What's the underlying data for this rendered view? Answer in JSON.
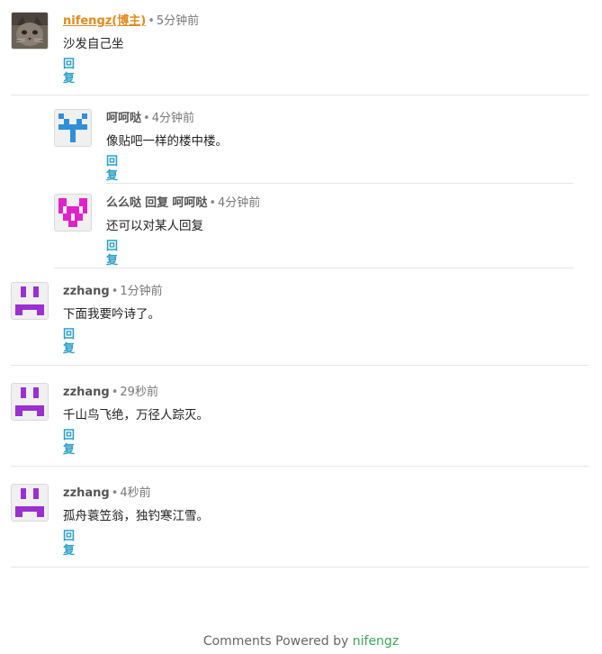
{
  "comments": [
    {
      "author": "nifengz(博主)",
      "time": "5分钟前",
      "text": "沙发自己坐",
      "reply": "回复",
      "avatar": "cat-photo-avatar"
    },
    {
      "author": "呵呵哒",
      "time": "4分钟前",
      "text": "像贴吧一样的楼中楼。",
      "reply": "回复",
      "avatar": "identicon-blue"
    },
    {
      "author": "么么哒",
      "reply_word": "回复",
      "reply_to": "呵呵哒",
      "time": "4分钟前",
      "text": "还可以对某人回复",
      "reply": "回复",
      "avatar": "identicon-magenta"
    },
    {
      "author": "zzhang",
      "time": "1分钟前",
      "text": "下面我要吟诗了。",
      "reply": "回复",
      "avatar": "identicon-purple"
    },
    {
      "author": "zzhang",
      "time": "29秒前",
      "text": "千山鸟飞绝，万径人踪灭。",
      "reply": "回复",
      "avatar": "identicon-purple"
    },
    {
      "author": "zzhang",
      "time": "4秒前",
      "text": "孤舟蓑笠翁，独钓寒江雪。",
      "reply": "回复",
      "avatar": "identicon-purple"
    }
  ],
  "separator": "•",
  "footer": {
    "prefix": "Comments Powered by ",
    "brand": "nifengz"
  },
  "colors": {
    "link": "#2c9fc9",
    "owner": "#e08a1e",
    "brand": "#3aa757",
    "identicon_blue": "#2f8fd8",
    "identicon_magenta": "#e023c8",
    "identicon_purple": "#9b2fd0"
  }
}
